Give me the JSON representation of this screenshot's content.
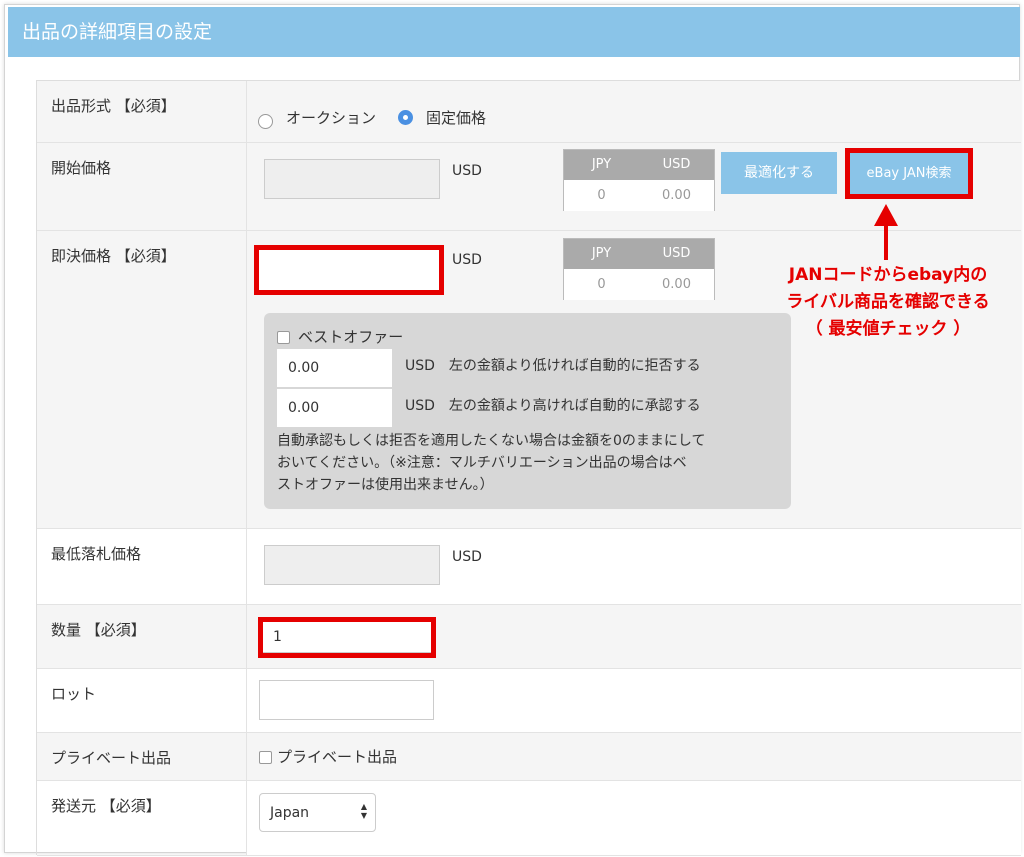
{
  "header": {
    "title": "出品の詳細項目の設定"
  },
  "rows": {
    "listing_format": {
      "label": "出品形式 【必須】",
      "options": [
        "オークション",
        "固定価格"
      ],
      "selected": "固定価格"
    },
    "start_price": {
      "label": "開始価格",
      "value": "",
      "unit": "USD",
      "conversion": {
        "jpy_header": "JPY",
        "usd_header": "USD",
        "jpy_value": "0",
        "usd_value": "0.00"
      },
      "optimize_button": "最適化する",
      "jan_button": "eBay JAN検索"
    },
    "buy_now_price": {
      "label": "即決価格 【必須】",
      "value": "",
      "unit": "USD",
      "conversion": {
        "jpy_header": "JPY",
        "usd_header": "USD",
        "jpy_value": "0",
        "usd_value": "0.00"
      }
    },
    "best_offer": {
      "checkbox_label": "ベストオファー",
      "checked": false,
      "decline_value": "0.00",
      "decline_text": "USD　左の金額より低ければ自動的に拒否する",
      "accept_value": "0.00",
      "accept_text": "USD　左の金額より高ければ自動的に承認する",
      "note_line1": "自動承認もしくは拒否を適用したくない場合は金額を0のままにして",
      "note_line2": "おいてください。（※注意：マルチバリエーション出品の場合はベ",
      "note_line3": "ストオファーは使用出来ません。）"
    },
    "reserve_price": {
      "label": "最低落札価格",
      "value": "",
      "unit": "USD"
    },
    "quantity": {
      "label": "数量 【必須】",
      "value": "1"
    },
    "lot": {
      "label": "ロット",
      "value": ""
    },
    "private_listing": {
      "label": "プライベート出品",
      "checkbox_label": "プライベート出品",
      "checked": false
    },
    "ship_from": {
      "label": "発送元 【必須】",
      "selected": "Japan"
    }
  },
  "annotation": {
    "line1": "JANコードからebay内の",
    "line2": "ライバル商品を確認できる",
    "line3": "（ 最安値チェック ）"
  },
  "colors": {
    "header_bg": "#8ac4e8",
    "button_bg": "#8ac4e8",
    "highlight_red": "#e50000",
    "radio_selected": "#4a90e2"
  }
}
